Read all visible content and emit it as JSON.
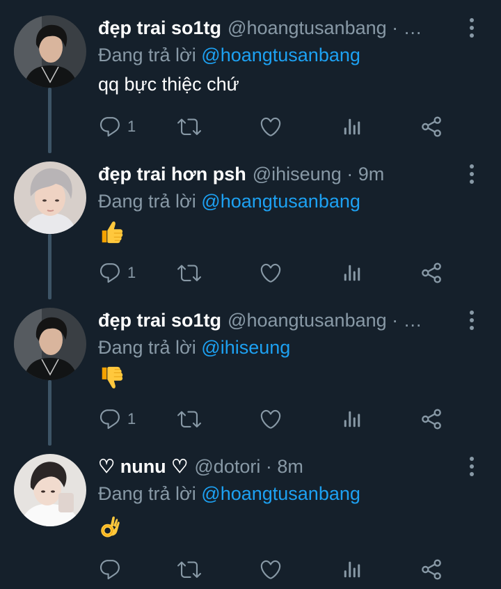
{
  "tweets": [
    {
      "display_name": "đẹp trai so1tg",
      "handle": "@hoangtusanbang · …",
      "replying_prefix": "Đang trả lời",
      "replying_to": "@hoangtusanbang",
      "text": "qq bực thiệc chứ",
      "emoji": "",
      "reply_count": "1",
      "avatar_icon": "avatar-dark-hair"
    },
    {
      "display_name": "đẹp trai hơn psh",
      "handle": "@ihiseung · 9m",
      "replying_prefix": "Đang trả lời",
      "replying_to": "@hoangtusanbang",
      "text": "",
      "emoji": "thumbs-up",
      "reply_count": "1",
      "avatar_icon": "avatar-silver-hair"
    },
    {
      "display_name": "đẹp trai so1tg",
      "handle": "@hoangtusanbang · …",
      "replying_prefix": "Đang trả lời",
      "replying_to": "@ihiseung",
      "text": "",
      "emoji": "thumbs-down",
      "reply_count": "1",
      "avatar_icon": "avatar-dark-hair"
    },
    {
      "display_name": "♡ nunu ♡",
      "handle": "@dotori · 8m",
      "replying_prefix": "Đang trả lời",
      "replying_to": "@hoangtusanbang",
      "text": "",
      "emoji": "ok-hand",
      "reply_count": "",
      "avatar_icon": "avatar-light"
    }
  ],
  "theme": {
    "background": "#15202b",
    "secondary_text": "#8899a6",
    "link": "#1da1f2",
    "thread_line": "#3d5466"
  }
}
